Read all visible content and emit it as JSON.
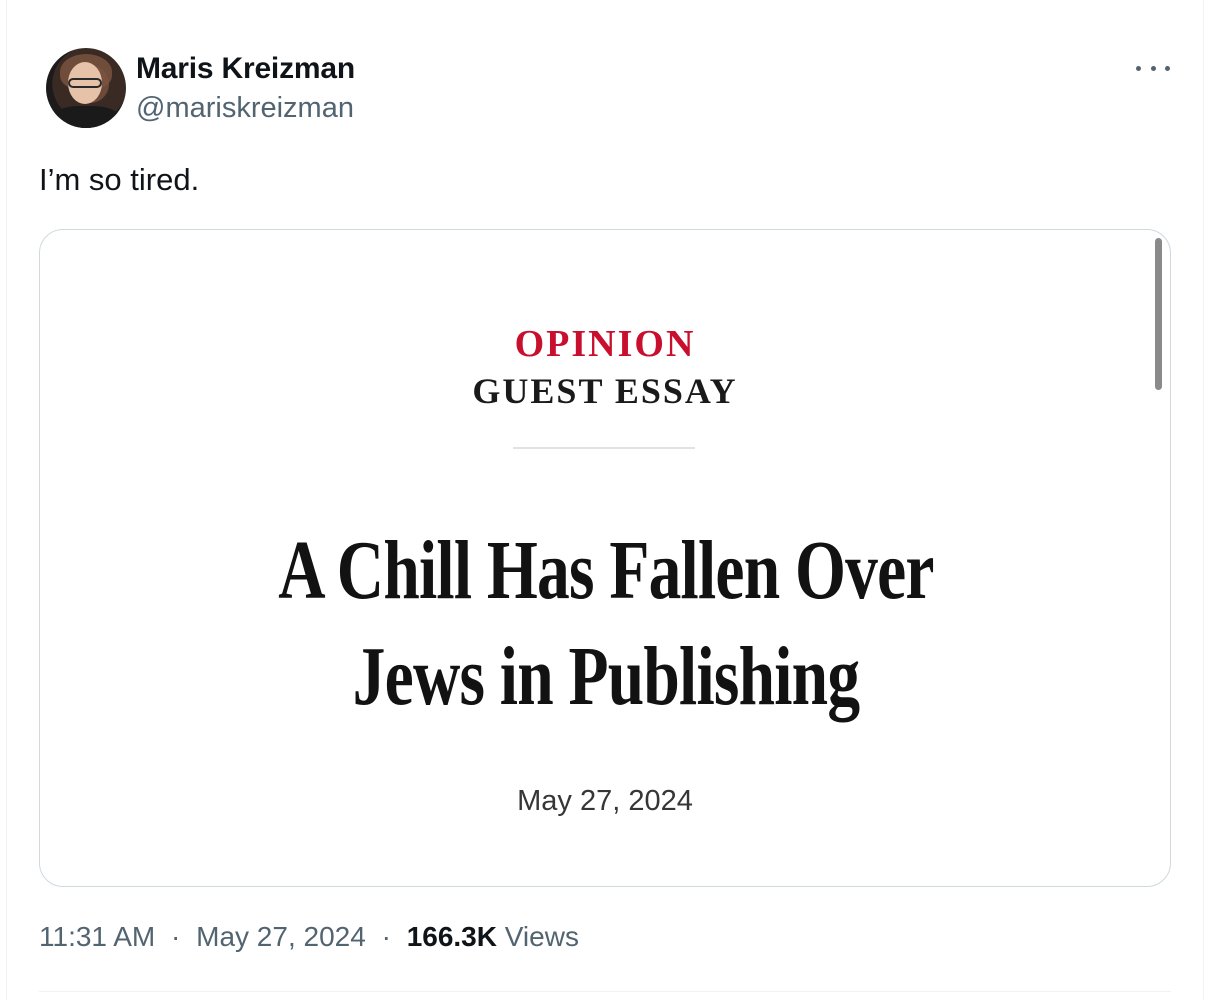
{
  "author": {
    "display_name": "Maris Kreizman",
    "handle": "@mariskreizman"
  },
  "tweet": {
    "text": "I’m so tired."
  },
  "card": {
    "section": "OPINION",
    "kicker": "GUEST ESSAY",
    "headline": "A Chill Has Fallen Over Jews in Publishing",
    "date": "May 27, 2024"
  },
  "meta": {
    "time": "11:31 AM",
    "separator": "·",
    "date": "May 27, 2024",
    "views_count": "166.3K",
    "views_label": "Views"
  },
  "icons": {
    "more": "more-horizontal-icon"
  },
  "colors": {
    "accent_red": "#c8102e",
    "secondary_text": "#536471",
    "border": "#cfd9de"
  }
}
